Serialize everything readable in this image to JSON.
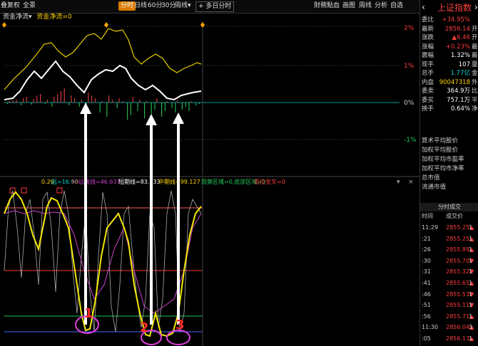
{
  "toolbar": {
    "items": [
      {
        "label": "叠",
        "x": 1
      },
      {
        "label": "复权",
        "x": 10
      },
      {
        "label": "全景",
        "x": 30
      }
    ],
    "periods": [
      "分时",
      "日线",
      "60分",
      "30分",
      "周线▾"
    ],
    "multi_day": "+ 多日分时",
    "right_items": [
      "財務點血",
      "画图",
      "周线",
      "分析",
      "自选"
    ]
  },
  "indicator1": {
    "name": "资金净流▾",
    "param": "资金净流=0",
    "axis": [
      "2%",
      "1%",
      "0%",
      "-1%"
    ]
  },
  "indicator2": {
    "legend": [
      {
        "text": "0.20",
        "color": "#ffd400"
      },
      {
        "text": "远=16.90",
        "color": "#00d8d8"
      },
      {
        "text": "50",
        "color": "#ff3b3b"
      },
      {
        "text": "远离线=46.637",
        "color": "#cc44cc"
      },
      {
        "text": "短期线=83.233",
        "color": "#ffffff"
      },
      {
        "text": "中期线=99.127",
        "color": "#ffd400"
      },
      {
        "text": "观察区域=0,底部区域=0",
        "color": "#22c85a"
      },
      {
        "text": "低位金叉=0",
        "color": "#ff3b3b"
      }
    ]
  },
  "annotations": {
    "marks": [
      "1",
      "2",
      "3"
    ]
  },
  "quote": {
    "title": "上证指数",
    "rows": [
      {
        "label": "委比",
        "value": "+34.95%",
        "cls": "red",
        "clip": ""
      },
      {
        "label": "最新",
        "value": "2856.14",
        "cls": "red",
        "clip": "开"
      },
      {
        "label": "涨跌",
        "value": "▲6.46",
        "cls": "red",
        "clip": "开"
      },
      {
        "label": "涨幅",
        "value": "+0.23%",
        "cls": "red",
        "clip": "最"
      },
      {
        "label": "震幅",
        "value": "1.32%",
        "cls": "white",
        "clip": "最"
      },
      {
        "label": "现手",
        "value": "107",
        "cls": "white",
        "clip": "量"
      },
      {
        "label": "总手",
        "value": "1.77亿",
        "cls": "cyan",
        "clip": "金"
      },
      {
        "label": "内盘",
        "value": "90047318",
        "cls": "yellow",
        "clip": "外"
      },
      {
        "label": "委卖",
        "value": "364.9万",
        "cls": "white",
        "clip": "比"
      },
      {
        "label": "委买",
        "value": "757.1万",
        "cls": "white",
        "clip": "平"
      },
      {
        "label": "换手",
        "value": "0.64%",
        "cls": "white",
        "clip": "净"
      }
    ],
    "extra": [
      "算术平均股价",
      "加权平均股价",
      "加权平均市盈率",
      "加权平均市净率",
      "总市值",
      "流通市值"
    ],
    "trades_title": "分时成交",
    "trades_header": [
      "时间",
      "成交价"
    ],
    "trades": [
      {
        "t": "11:29",
        "p": "2855.25▲",
        "v": "1"
      },
      {
        "t": ":21",
        "p": "2855.25▲",
        "v": "1"
      },
      {
        "t": ":26",
        "p": "2855.89▲",
        "v": "1"
      },
      {
        "t": ":30",
        "p": "2855.70▼",
        "v": "1"
      },
      {
        "t": ":31",
        "p": "2855.32▼",
        "v": "1"
      },
      {
        "t": ":41",
        "p": "2855.65▲",
        "v": "1"
      },
      {
        "t": ":46",
        "p": "2855.53▼",
        "v": "1"
      },
      {
        "t": ":51",
        "p": "2855.11▼",
        "v": "1"
      },
      {
        "t": ":56",
        "p": "2855.71▲",
        "v": "1"
      },
      {
        "t": "11:30",
        "p": "2856.04▲",
        "v": "3"
      },
      {
        "t": ":05",
        "p": "2856.13▲",
        "v": "1"
      }
    ]
  },
  "colors": {
    "up": "#ff3b3b",
    "down": "#22c85a",
    "bg": "#000000"
  }
}
